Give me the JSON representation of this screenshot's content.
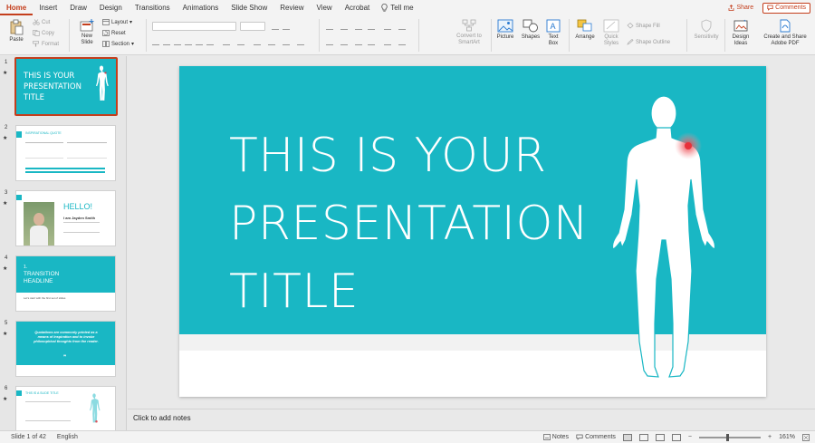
{
  "menu": {
    "tabs": [
      "Home",
      "Insert",
      "Draw",
      "Design",
      "Transitions",
      "Animations",
      "Slide Show",
      "Review",
      "View",
      "Acrobat"
    ],
    "tell_me": "Tell me",
    "share": "Share",
    "comments": "Comments"
  },
  "ribbon": {
    "paste": "Paste",
    "cut": "Cut",
    "copy": "Copy",
    "format": "Format",
    "new_slide": "New\nSlide",
    "layout": "Layout",
    "reset": "Reset",
    "section": "Section",
    "convert_smartart": "Convert to\nSmartArt",
    "picture": "Picture",
    "shapes": "Shapes",
    "text_box": "Text\nBox",
    "arrange": "Arrange",
    "quick_styles": "Quick\nStyles",
    "shape_fill": "Shape Fill",
    "shape_outline": "Shape Outline",
    "sensitivity": "Sensitivity",
    "design_ideas": "Design\nIdeas",
    "create_share_pdf": "Create and Share\nAdobe PDF"
  },
  "thumbnails": {
    "numbers": [
      "1",
      "2",
      "3",
      "4",
      "5",
      "6"
    ],
    "slide2_title": "INSPIRATIONAL QUOTE",
    "slide3_hello": "HELLO!",
    "slide3_name": "I am Jayden Smith",
    "slide4_num": "1.",
    "slide4_title": "TRANSITION\nHEADLINE",
    "slide4_sub": "Let's start with the first set of slides",
    "slide5_quote": "Quotations are commonly printed as a means of inspiration and to invoke philosophical thoughts from the reader.",
    "slide6_title": "THIS IS A SLIDE TITLE"
  },
  "slide": {
    "title_lines": [
      "THIS IS YOUR",
      "PRESENTATION",
      "TITLE"
    ],
    "accent_color": "#19b7c4",
    "highlight_color": "#e8313a"
  },
  "notes_placeholder": "Click to add notes",
  "status": {
    "slide_of": "Slide 1 of 42",
    "language": "English",
    "notes": "Notes",
    "comments": "Comments",
    "zoom": "161%"
  }
}
